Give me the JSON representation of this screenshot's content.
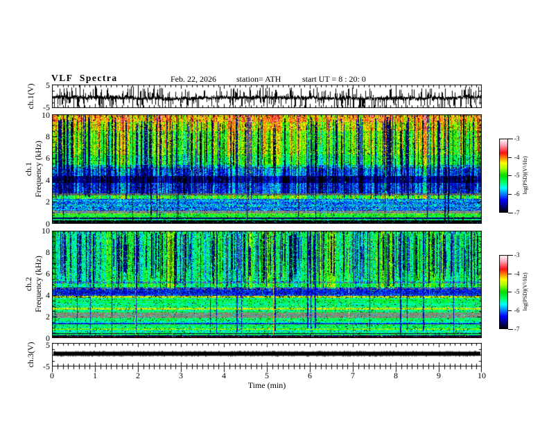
{
  "header": {
    "title": "VLF Spectra",
    "date": "Feb. 22, 2026",
    "station": "station= ATH",
    "start_ut": "start UT =  8 : 20: 0"
  },
  "xaxis": {
    "label": "Time (min)",
    "ticks": [
      "0",
      "1",
      "2",
      "3",
      "4",
      "5",
      "6",
      "7",
      "8",
      "9",
      "10"
    ]
  },
  "colorbar": {
    "label": "log(PSD)(V²/Hz)",
    "ticks": [
      "-3",
      "-4",
      "-5",
      "-6",
      "-7"
    ]
  },
  "panels": {
    "ch1wave": {
      "ylabel": "ch.1(V)",
      "ytop": "5",
      "ybottom": "-5"
    },
    "spec1": {
      "ylabel1": "ch.1",
      "ylabel2": "Frequency (kHz)",
      "yticks": [
        "10",
        "8",
        "6",
        "4",
        "2",
        "0"
      ]
    },
    "spec2": {
      "ylabel1": "ch.2",
      "ylabel2": "Frequency (kHz)",
      "yticks": [
        "10",
        "8",
        "6",
        "4",
        "2",
        "0"
      ]
    },
    "ch3wave": {
      "ylabel": "ch.3(V)",
      "ytop": "5",
      "ybottom": "-5"
    }
  },
  "chart_data": [
    {
      "id": "ch1_waveform",
      "type": "line",
      "xlabel": "Time (min)",
      "xrange": [
        0,
        10
      ],
      "ylabel": "ch.1(V)",
      "yrange": [
        -5,
        5
      ],
      "summary": "continuous noisy voltage trace, baseline near -0.6 V, dense impulsive spikes reaching +-5 V",
      "gen": {
        "seed": 11,
        "mean": -0.65,
        "sd": 0.45,
        "samples_per_col": 5,
        "spike_prob": 0.12,
        "spike_min": 1.2,
        "spike_max": 4.6,
        "down_frac": 0.52
      }
    },
    {
      "id": "ch1_spectrogram",
      "type": "heatmap",
      "xlabel": "Time (min)",
      "xrange": [
        0,
        10
      ],
      "ylabel": "ch.1 Frequency (kHz)",
      "yrange": [
        0,
        10
      ],
      "zlabel": "log(PSD)(V²/Hz)",
      "zrange": [
        -7,
        -3
      ],
      "seed": 42,
      "colvar": {
        "fmin": 2.25,
        "amp": 0.55,
        "ampBelow": 0.12
      },
      "bands": [
        {
          "f": [
            9.3,
            10
          ],
          "v": -4.15,
          "n": 0.45
        },
        {
          "f": [
            8.5,
            9.3
          ],
          "v": -4.5,
          "n": 0.45
        },
        {
          "f": [
            6.3,
            8.5
          ],
          "v": -4.85,
          "n": 0.4
        },
        {
          "f": [
            5.35,
            6.3
          ],
          "v": -5.15,
          "n": 0.35
        },
        {
          "f": [
            5.08,
            5.35
          ],
          "v": -5.7,
          "n": 0.3
        },
        {
          "f": [
            4.35,
            5.08
          ],
          "v": -6.1,
          "n": 0.4
        },
        {
          "f": [
            3.75,
            4.35
          ],
          "v": -6.75,
          "n": 0.25
        },
        {
          "f": [
            2.8,
            3.75
          ],
          "v": -6.3,
          "n": 0.4
        },
        {
          "f": [
            2.6,
            2.8
          ],
          "v": -6.3,
          "n": 0.3,
          "gray": 105
        },
        {
          "f": [
            2.25,
            2.6
          ],
          "v": -5.0,
          "n": 0.45
        },
        {
          "f": [
            1.2,
            2.25
          ],
          "v": -6.0,
          "n": 0.5
        },
        {
          "f": [
            0.92,
            1.2
          ],
          "v": -5.9,
          "n": 0.35,
          "gray": 138
        },
        {
          "f": [
            0.55,
            0.92
          ],
          "v": -5.05,
          "n": 0.45
        },
        {
          "f": [
            0.42,
            0.55
          ],
          "v": -6.7,
          "n": 0.3
        },
        {
          "f": [
            0.3,
            0.42
          ],
          "v": -5.4,
          "n": 0.4
        },
        {
          "f": [
            0.08,
            0.3
          ],
          "v": -6.95,
          "n": 0.15,
          "bright_speckle": 0.06
        },
        {
          "f": [
            0,
            0.08
          ],
          "v": -7.0,
          "n": 0.05
        }
      ],
      "dash_lines": [
        {
          "f": 5.2,
          "gray": 70
        }
      ],
      "streaks": [
        {
          "count": 130,
          "fTop": [
            9,
            10
          ],
          "fBot": [
            2.3,
            4.5
          ],
          "v": -6.7,
          "vn": 0.25
        },
        {
          "count": 50,
          "fTop": [
            8,
            10
          ],
          "fBot": [
            4.5,
            6
          ],
          "v": -7.0,
          "vn": 0.15
        },
        {
          "count": 60,
          "fTop": [
            9.7,
            10
          ],
          "fBot": [
            6,
            8
          ],
          "v": -4.05,
          "vn": 0.25
        },
        {
          "count": 15,
          "fTop": [
            10,
            10
          ],
          "fBot": [
            0,
            0.5
          ],
          "v": -6.8,
          "vn": 0.2
        }
      ]
    },
    {
      "id": "ch2_spectrogram",
      "type": "heatmap",
      "xlabel": "Time (min)",
      "xrange": [
        0,
        10
      ],
      "ylabel": "ch.2 Frequency (kHz)",
      "yrange": [
        0,
        10
      ],
      "zlabel": "log(PSD)(V²/Hz)",
      "zrange": [
        -7,
        -3
      ],
      "seed": 77,
      "colvar": {
        "fmin": 4.55,
        "amp": 0.5,
        "ampBelow": 0.15
      },
      "bands": [
        {
          "f": [
            5.3,
            10
          ],
          "v": -5.35,
          "n": 0.4
        },
        {
          "f": [
            5.1,
            5.3
          ],
          "v": -5.8,
          "n": 0.35
        },
        {
          "f": [
            4.72,
            5.1
          ],
          "v": -5.25,
          "n": 0.35
        },
        {
          "f": [
            3.92,
            4.72
          ],
          "v": -6.3,
          "n": 0.4
        },
        {
          "f": [
            3.72,
            3.92
          ],
          "v": -4.35,
          "n": 0.5,
          "dark_speckle": 0.15
        },
        {
          "f": [
            2.84,
            3.72
          ],
          "v": -5.35,
          "n": 0.35
        },
        {
          "f": [
            2.66,
            2.84
          ],
          "v": -4.65,
          "n": 0.4
        },
        {
          "f": [
            2.36,
            2.66
          ],
          "v": -5.4,
          "n": 0.35
        },
        {
          "f": [
            1.9,
            2.36
          ],
          "v": -5.6,
          "n": 0.3,
          "gray": 135
        },
        {
          "f": [
            1.4,
            1.9
          ],
          "v": -5.5,
          "n": 0.35
        },
        {
          "f": [
            1.26,
            1.4
          ],
          "v": -6.3,
          "n": 0.3
        },
        {
          "f": [
            0.92,
            1.26
          ],
          "v": -5.35,
          "n": 0.4
        },
        {
          "f": [
            0.78,
            0.92
          ],
          "v": -4.75,
          "n": 0.35
        },
        {
          "f": [
            0.48,
            0.78
          ],
          "v": -5.5,
          "n": 0.35
        },
        {
          "f": [
            0.36,
            0.48
          ],
          "v": -6.8,
          "n": 0.25
        },
        {
          "f": [
            0.24,
            0.36
          ],
          "v": -5.3,
          "n": 0.35
        },
        {
          "f": [
            0.1,
            0.24
          ],
          "v": -7.0,
          "n": 0.1,
          "bright_speckle": 0.05
        },
        {
          "f": [
            0,
            0.1
          ],
          "v": -4.5,
          "n": 0.2,
          "maroon": true
        }
      ],
      "dash_lines": [
        {
          "f": 5.2,
          "gray": 110
        },
        {
          "f": 4.62,
          "gray": 110
        }
      ],
      "streaks": [
        {
          "count": 170,
          "fTop": [
            9.5,
            10
          ],
          "fBot": [
            4.6,
            6.5
          ],
          "v": -6.8,
          "vn": 0.25
        },
        {
          "count": 60,
          "fTop": [
            8,
            9.5
          ],
          "fBot": [
            5.5,
            7.5
          ],
          "v": -6.6,
          "vn": 0.3
        },
        {
          "count": 20,
          "fTop": [
            10,
            10
          ],
          "fBot": [
            0.3,
            1
          ],
          "v": -6.5,
          "vn": 0.3
        },
        {
          "count": 3,
          "fixed_t": [
            1.93,
            5.15,
            6.9
          ],
          "fTop": [
            10,
            10
          ],
          "fBot": [
            0.3,
            0.5
          ],
          "v": -4.2,
          "vn": 0.25
        }
      ]
    },
    {
      "id": "ch3_waveform",
      "type": "line",
      "xlabel": "Time (min)",
      "xrange": [
        0,
        10
      ],
      "ylabel": "ch.3(V)",
      "yrange": [
        -5,
        5
      ],
      "summary": "flat saturated trace: thick constant black band near +0.4 V across full record",
      "gen": {
        "seed": 5,
        "band_v_top": 1.3,
        "band_v_bottom": -0.45
      }
    }
  ]
}
